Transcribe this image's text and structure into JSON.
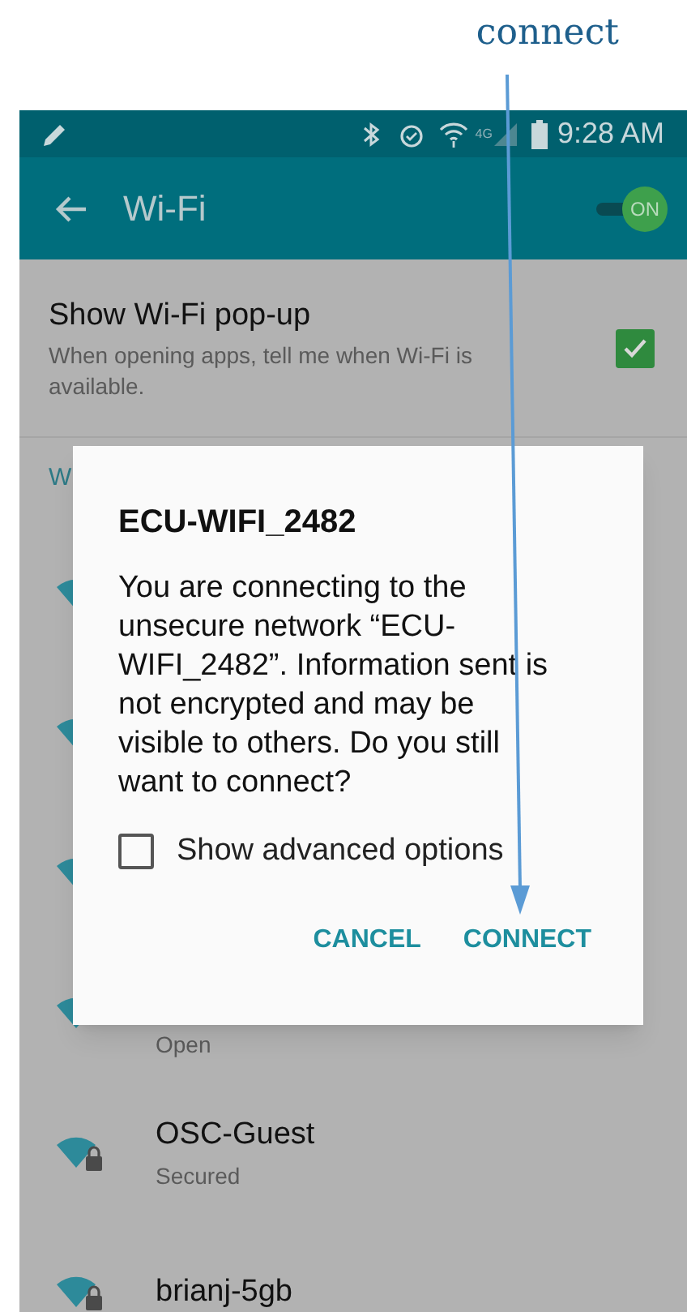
{
  "annotation": {
    "label": "connect"
  },
  "status_bar": {
    "network": "4G",
    "time": "9:28 AM"
  },
  "app_bar": {
    "title": "Wi-Fi",
    "switch_label": "ON",
    "on": true
  },
  "popup_setting": {
    "title": "Show Wi-Fi pop-up",
    "description": "When opening apps, tell me when Wi-Fi is available.",
    "checked": true
  },
  "section_header": "W",
  "networks": [
    {
      "kind": "network"
    },
    {
      "kind": "network"
    },
    {
      "kind": "network"
    },
    {
      "kind": "network",
      "status": "Open"
    },
    {
      "kind": "network",
      "name": "OSC-Guest",
      "status": "Secured",
      "secured": true
    },
    {
      "kind": "network",
      "name": "brianj-5gb",
      "secured": true
    }
  ],
  "dialog": {
    "title": "ECU-WIFI_2482",
    "message": "You are connecting to the unsecure network “ECU-WIFI_2482”. Information sent is not encrypted and may be visible to others. Do you still want to connect?",
    "option": {
      "label": "Show advanced options",
      "checked": false
    },
    "buttons": [
      "CANCEL",
      "CONNECT"
    ]
  }
}
